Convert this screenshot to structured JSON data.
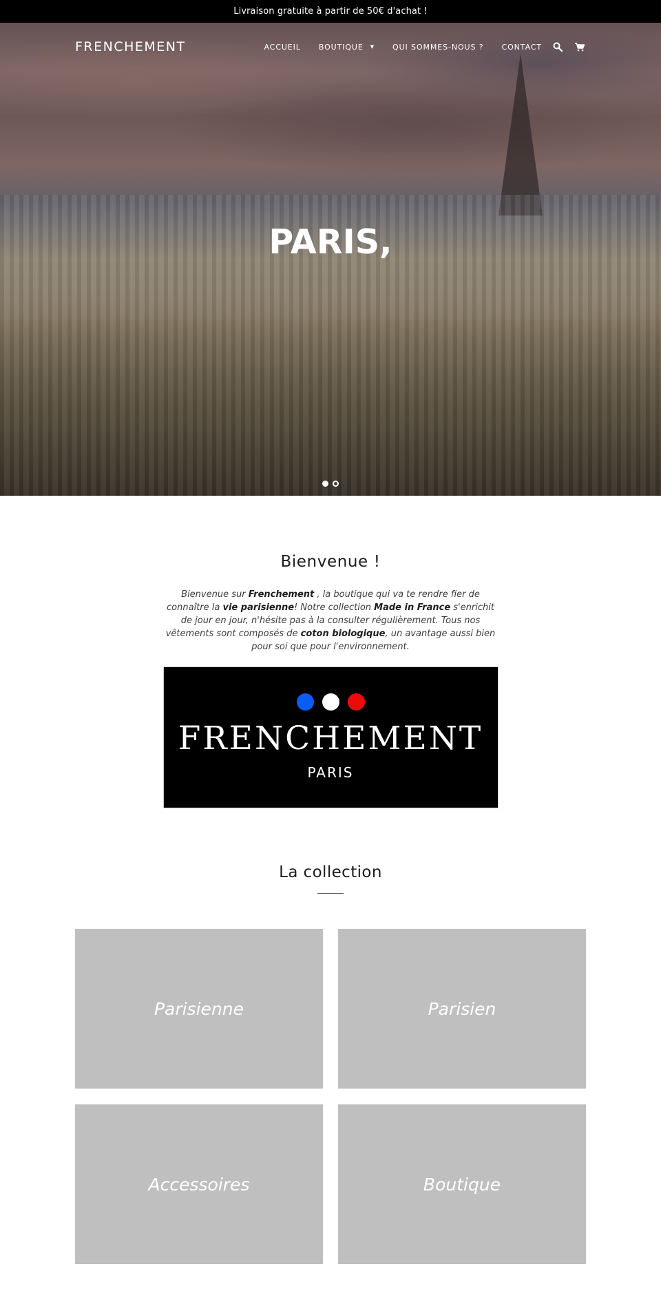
{
  "announcement": "Livraison gratuite à partir de 50€ d'achat !",
  "header": {
    "logo": "FRENCHEMENT",
    "nav": [
      {
        "label": "ACCUEIL",
        "has_dropdown": false
      },
      {
        "label": "BOUTIQUE",
        "has_dropdown": true
      },
      {
        "label": "QUI SOMMES-NOUS ?",
        "has_dropdown": false
      },
      {
        "label": "CONTACT",
        "has_dropdown": false
      }
    ],
    "icons": {
      "search": "search-icon",
      "cart": "cart-icon"
    },
    "caret": "▼"
  },
  "hero": {
    "title": "PARIS,",
    "slides_count": 2,
    "active_slide": 1
  },
  "welcome": {
    "title": "Bienvenue !",
    "text_parts": [
      {
        "t": "Bienvenue sur ",
        "b": false
      },
      {
        "t": "Frenchement",
        "b": true
      },
      {
        "t": " , la boutique qui va te rendre fier de connaître la ",
        "b": false
      },
      {
        "t": "vie parisienne",
        "b": true
      },
      {
        "t": "! Notre collection ",
        "b": false
      },
      {
        "t": "Made in France",
        "b": true
      },
      {
        "t": " s'enrichit de jour en jour, n'hésite pas à la consulter régulièrement. Tous nos vêtements sont composés de ",
        "b": false
      },
      {
        "t": "coton biologique",
        "b": true
      },
      {
        "t": ", un avantage aussi bien pour soi que pour l'environnement.",
        "b": false
      }
    ]
  },
  "brand_banner": {
    "name": "FRENCHEMENT",
    "sub": "PARIS",
    "colors": [
      "#0a5cf5",
      "#ffffff",
      "#ef0a0a"
    ]
  },
  "collection": {
    "title": "La collection",
    "tiles": [
      {
        "label": "Parisienne"
      },
      {
        "label": "Parisien"
      },
      {
        "label": "Accessoires"
      },
      {
        "label": "Boutique"
      }
    ]
  }
}
